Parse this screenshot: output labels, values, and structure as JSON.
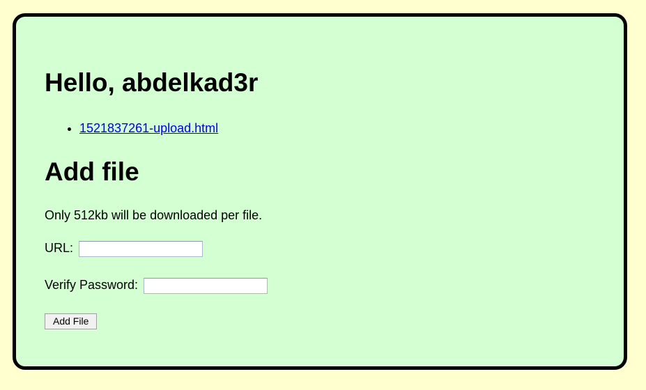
{
  "greeting": "Hello, abdelkad3r",
  "files": [
    {
      "name": "1521837261-upload.html"
    }
  ],
  "add_file": {
    "title": "Add file",
    "note": "Only 512kb will be downloaded per file.",
    "url_label": "URL:",
    "url_value": "",
    "password_label": "Verify Password:",
    "password_value": "",
    "submit_label": "Add File"
  },
  "colors": {
    "page_background": "#ffffd0",
    "panel_background": "#d3ffd3",
    "panel_border": "#000000",
    "link": "#0000ee"
  }
}
